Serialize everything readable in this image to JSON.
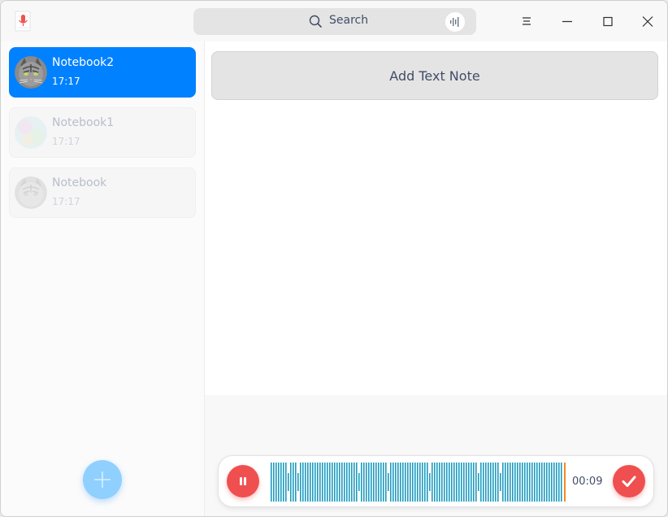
{
  "titlebar": {
    "search_placeholder": "Search",
    "icons": [
      "voice-recorder-app-icon",
      "search-icon",
      "microphone-waveform-icon",
      "menu-icon",
      "minimize-icon",
      "maximize-icon",
      "close-icon"
    ]
  },
  "sidebar": {
    "notebooks": [
      {
        "name": "Notebook2",
        "time": "17:17",
        "active": true
      },
      {
        "name": "Notebook1",
        "time": "17:17",
        "active": false
      },
      {
        "name": "Notebook",
        "time": "17:17",
        "active": false
      }
    ],
    "add_icon": "plus-icon"
  },
  "main": {
    "add_text_note": "Add Text Note"
  },
  "recorder": {
    "elapsed": "00:09",
    "accent": "#f04f4f",
    "wave_color": "#1e9bbf"
  }
}
